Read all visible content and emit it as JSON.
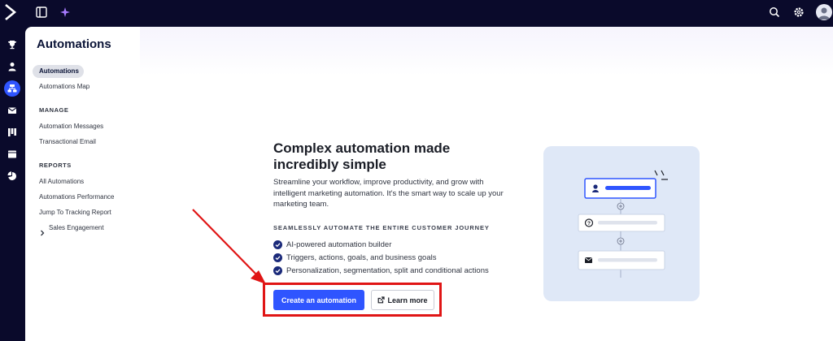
{
  "topbar": {
    "logo_icon": "activecampaign-logo-icon",
    "left_icons": [
      "sidebar-toggle-icon",
      "sparkle-icon"
    ],
    "right_icons": [
      "search-icon",
      "gear-icon",
      "avatar"
    ]
  },
  "rail": {
    "icons": [
      "trophy-icon",
      "contacts-icon",
      "automations-icon",
      "campaigns-icon",
      "deals-icon",
      "website-icon",
      "reports-icon"
    ],
    "active": "automations-icon"
  },
  "sidebar": {
    "title": "Automations",
    "items": [
      {
        "label": "Automations",
        "active": true
      },
      {
        "label": "Automations Map",
        "active": false
      }
    ],
    "sections": [
      {
        "title": "MANAGE",
        "items": [
          "Automation Messages",
          "Transactional Email"
        ]
      },
      {
        "title": "REPORTS",
        "items": [
          "All Automations",
          "Automations Performance",
          "Jump To Tracking Report",
          "Sales Engagement"
        ]
      }
    ]
  },
  "main": {
    "title": "Complex automation made incredibly simple",
    "description": "Streamline your workflow, improve productivity, and grow with intelligent marketing automation. It's the smart way to scale up your marketing team.",
    "caption": "SEAMLESSLY AUTOMATE THE ENTIRE CUSTOMER JOURNEY",
    "features": [
      "AI-powered automation builder",
      "Triggers, actions, goals, and business goals",
      "Personalization, segmentation, split and conditional actions"
    ],
    "primary_button": "Create an automation",
    "secondary_button": "Learn more",
    "secondary_button_icon": "external-link-icon"
  },
  "colors": {
    "nav_background": "#0a0a2b",
    "accent": "#2f55ff",
    "highlight": "#e01515",
    "illustration_bg": "#dfe8f7"
  }
}
